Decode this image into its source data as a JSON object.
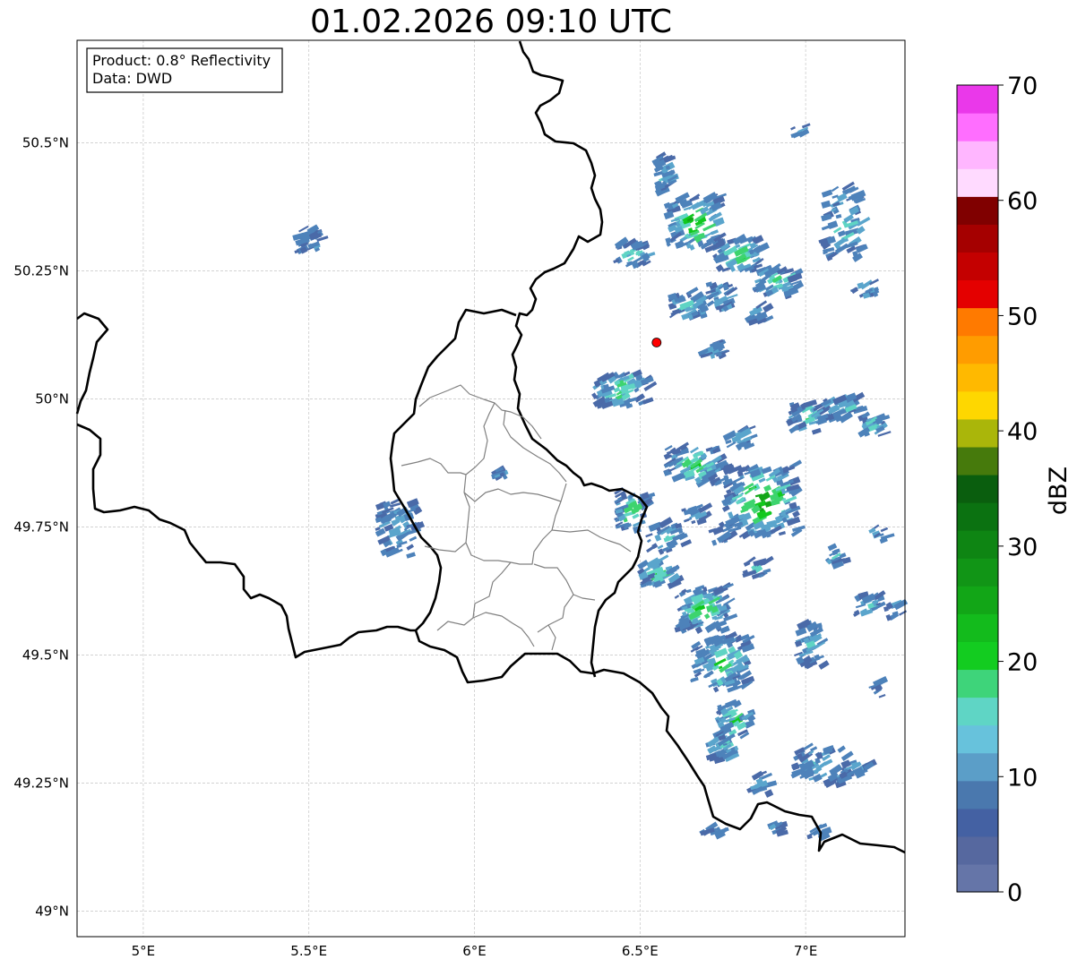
{
  "title": "01.02.2026 09:10 UTC",
  "info_box": {
    "product": "Product: 0.8° Reflectivity",
    "source": "Data: DWD"
  },
  "axes": {
    "lon_ticks": [
      {
        "value": 5.0,
        "label": "5°E"
      },
      {
        "value": 5.5,
        "label": "5.5°E"
      },
      {
        "value": 6.0,
        "label": "6°E"
      },
      {
        "value": 6.5,
        "label": "6.5°E"
      },
      {
        "value": 7.0,
        "label": "7°E"
      }
    ],
    "lat_ticks": [
      {
        "value": 50.5,
        "label": "50.5°N"
      },
      {
        "value": 50.25,
        "label": "50.25°N"
      },
      {
        "value": 50.0,
        "label": "50°N"
      },
      {
        "value": 49.75,
        "label": "49.75°N"
      },
      {
        "value": 49.5,
        "label": "49.5°N"
      },
      {
        "value": 49.25,
        "label": "49.25°N"
      },
      {
        "value": 49.0,
        "label": "49°N"
      }
    ],
    "lon_range": [
      4.8,
      7.3
    ],
    "lat_range": [
      48.95,
      50.7
    ],
    "grid": true
  },
  "radar_site": {
    "lon": 6.55,
    "lat": 50.11,
    "color": "#ff0000"
  },
  "colorbar": {
    "label": "dBZ",
    "range": [
      0,
      70
    ],
    "ticks": [
      {
        "value": 0,
        "label": "0"
      },
      {
        "value": 10,
        "label": "10"
      },
      {
        "value": 20,
        "label": "20"
      },
      {
        "value": 30,
        "label": "30"
      },
      {
        "value": 40,
        "label": "40"
      },
      {
        "value": 50,
        "label": "50"
      },
      {
        "value": 60,
        "label": "60"
      },
      {
        "value": 70,
        "label": "70"
      }
    ],
    "colors": [
      "#6575a8",
      "#56689f",
      "#4461a3",
      "#4a78ae",
      "#5b9ec8",
      "#67c2dc",
      "#5fd5c5",
      "#3ed47a",
      "#13cc20",
      "#13bb1c",
      "#12a617",
      "#119516",
      "#0e8513",
      "#0b7211",
      "#0a5e0e",
      "#467a0c",
      "#aab60a",
      "#fed700",
      "#ffb900",
      "#ff9c00",
      "#ff7a00",
      "#e40000",
      "#c40000",
      "#a50000",
      "#800000",
      "#ffdaff",
      "#ffb6ff",
      "#ff6eff",
      "#ea38ea"
    ]
  },
  "precip_palette": [
    "#4a6aa8",
    "#4d82ba",
    "#5aa5cc",
    "#5fd4c4",
    "#3dd46e",
    "#11c81d",
    "#12a617"
  ],
  "lines": {
    "border_color": "#000000",
    "admin_color": "#808080"
  }
}
